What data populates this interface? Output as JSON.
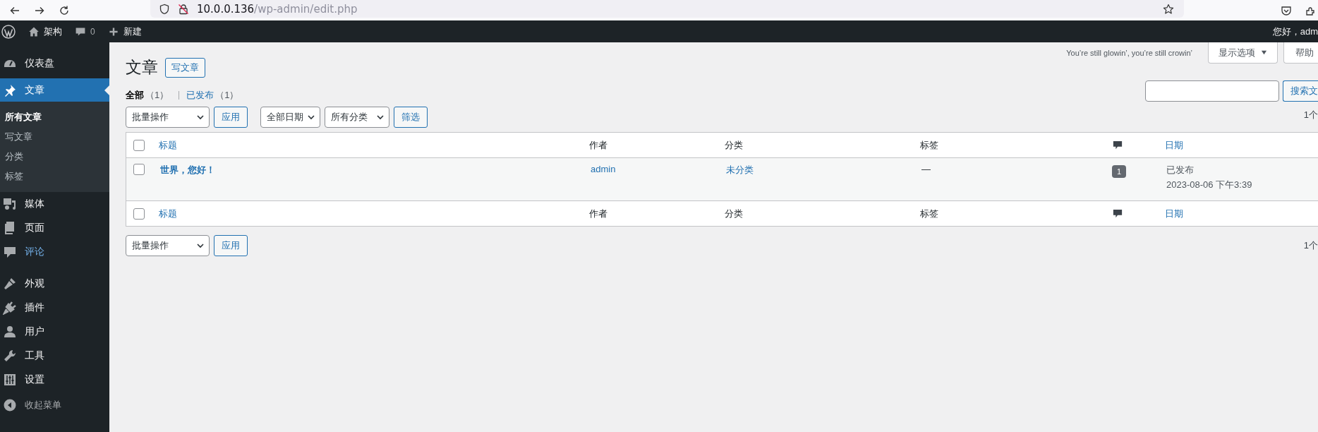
{
  "browser": {
    "url_host": "10.0.0.136",
    "url_path": "/wp-admin/edit.php"
  },
  "admin_bar": {
    "site_name": "架构",
    "comments_count": "0",
    "new_label": "新建",
    "greeting": "您好，adm"
  },
  "sidebar": {
    "groups": [
      [
        {
          "label": "仪表盘",
          "selected": false,
          "hover": false
        },
        {
          "label": "文章",
          "selected": true,
          "hover": false,
          "children": [
            {
              "label": "所有文章",
              "selected": true
            },
            {
              "label": "写文章",
              "selected": false
            },
            {
              "label": "分类",
              "selected": false
            },
            {
              "label": "标签",
              "selected": false
            }
          ]
        },
        {
          "label": "媒体",
          "selected": false,
          "hover": false
        },
        {
          "label": "页面",
          "selected": false,
          "hover": false
        },
        {
          "label": "评论",
          "selected": false,
          "hover": true
        }
      ],
      [
        {
          "label": "外观",
          "selected": false,
          "hover": false
        },
        {
          "label": "插件",
          "selected": false,
          "hover": false
        },
        {
          "label": "用户",
          "selected": false,
          "hover": false
        },
        {
          "label": "工具",
          "selected": false,
          "hover": false
        },
        {
          "label": "设置",
          "selected": false,
          "hover": false
        }
      ]
    ],
    "collapse_label": "收起菜单"
  },
  "header": {
    "title": "文章",
    "add_new": "写文章",
    "dolly": "You’re still glowin’, you’re still crowin’",
    "screen_options": "显示选项",
    "help": "帮助"
  },
  "views": [
    {
      "label": "全部",
      "count": "（1）",
      "selected": true
    },
    {
      "label": "已发布",
      "count": "（1）",
      "selected": false
    }
  ],
  "search": {
    "button": "搜索文"
  },
  "top_filters": {
    "bulk_action": "批量操作",
    "apply": "应用",
    "date": "全部日期",
    "category": "所有分类",
    "filter": "筛选"
  },
  "pagination_top": "1个",
  "table": {
    "columns": [
      {
        "kind": "check",
        "checked": false
      },
      {
        "kind": "text",
        "label": "标题",
        "sortable": true
      },
      {
        "kind": "text",
        "label": "作者",
        "sortable": false
      },
      {
        "kind": "text",
        "label": "分类",
        "sortable": false
      },
      {
        "kind": "text",
        "label": "标签",
        "sortable": false
      },
      {
        "kind": "comments"
      },
      {
        "kind": "text",
        "label": "日期",
        "sortable": true
      }
    ],
    "rows": [
      {
        "checked": false,
        "title": "世界，您好！",
        "author": "admin",
        "category": "未分类",
        "tags": "—",
        "comments": "1",
        "status": "已发布",
        "date": "2023-08-06 下午3:39"
      }
    ],
    "footer_columns": [
      {
        "kind": "check",
        "checked": false
      },
      {
        "kind": "text",
        "label": "标题",
        "sortable": true
      },
      {
        "kind": "text",
        "label": "作者",
        "sortable": false
      },
      {
        "kind": "text",
        "label": "分类",
        "sortable": false
      },
      {
        "kind": "text",
        "label": "标签",
        "sortable": false
      },
      {
        "kind": "comments"
      },
      {
        "kind": "text",
        "label": "日期",
        "sortable": true
      }
    ]
  },
  "bottom_filters": {
    "bulk_action": "批量操作",
    "apply": "应用"
  },
  "pagination_bottom": "1个"
}
